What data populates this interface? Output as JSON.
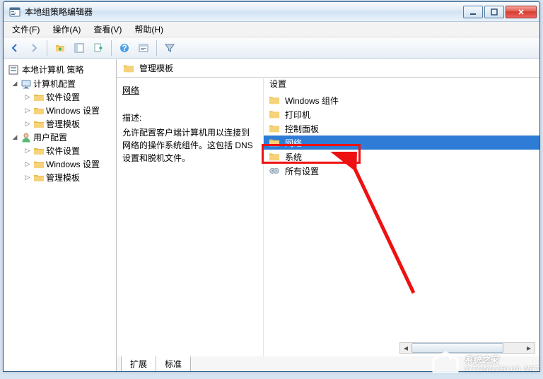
{
  "window": {
    "title": "本地组策略编辑器"
  },
  "menu": {
    "file": "文件(F)",
    "action": "操作(A)",
    "view": "查看(V)",
    "help": "帮助(H)"
  },
  "tree": {
    "root": "本地计算机 策略",
    "computer": "计算机配置",
    "user": "用户配置",
    "software": "软件设置",
    "windows": "Windows 设置",
    "templates": "管理模板"
  },
  "right": {
    "header": "管理模板",
    "col_left_header": "网络",
    "desc_label": "描述:",
    "desc_text": "允许配置客户端计算机用以连接到网络的操作系统组件。这包括 DNS 设置和脱机文件。",
    "col_right_header": "设置",
    "items": [
      {
        "label": "Windows 组件",
        "kind": "folder"
      },
      {
        "label": "打印机",
        "kind": "folder"
      },
      {
        "label": "控制面板",
        "kind": "folder"
      },
      {
        "label": "网络",
        "kind": "folder",
        "selected": true
      },
      {
        "label": "系统",
        "kind": "folder"
      },
      {
        "label": "所有设置",
        "kind": "settings"
      }
    ]
  },
  "tabs": {
    "extended": "扩展",
    "standard": "标准"
  },
  "watermark": {
    "name": "系统之家",
    "url": "XITONGZHIJIA.NET"
  }
}
